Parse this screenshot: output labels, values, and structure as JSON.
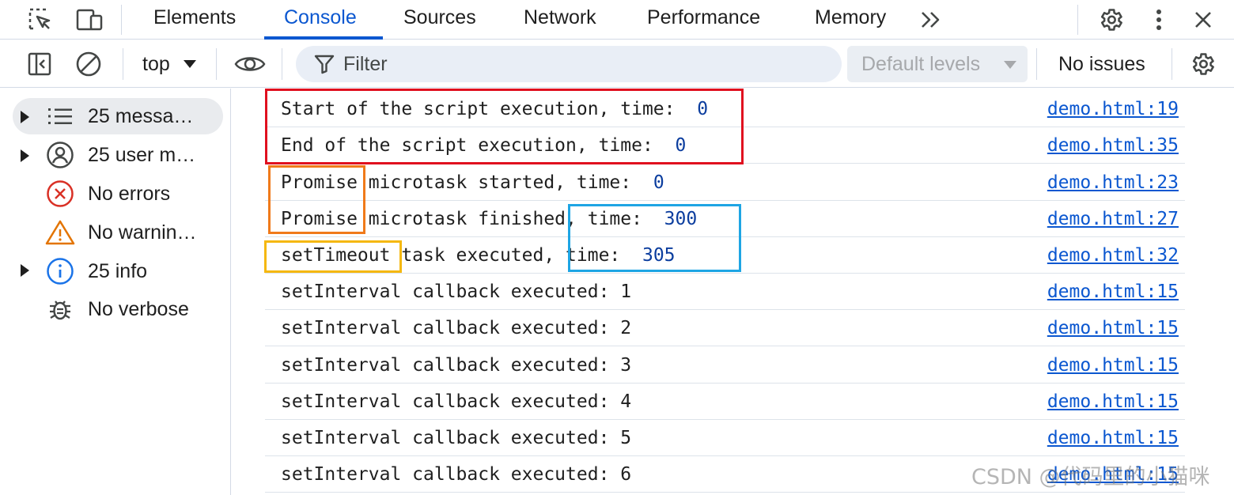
{
  "toolbar_top": {
    "icons": [
      "select-element-icon",
      "device-toolbar-icon"
    ],
    "tabs": [
      {
        "label": "Elements",
        "active": false
      },
      {
        "label": "Console",
        "active": true
      },
      {
        "label": "Sources",
        "active": false
      },
      {
        "label": "Network",
        "active": false
      },
      {
        "label": "Performance",
        "active": false
      },
      {
        "label": "Memory",
        "active": false
      }
    ],
    "more_tabs_glyph": "»",
    "right_icons": [
      "settings-icon",
      "more-options-icon",
      "close-icon"
    ]
  },
  "console_toolbar": {
    "context": "top",
    "filter": {
      "placeholder": "Filter",
      "value": ""
    },
    "levels": "Default levels",
    "issues": "No issues"
  },
  "sidebar": {
    "items": [
      {
        "label": "25 messa…",
        "icon": "list-icon",
        "expandable": true,
        "selected": true
      },
      {
        "label": "25 user m…",
        "icon": "user-icon",
        "expandable": true,
        "selected": false
      },
      {
        "label": "No errors",
        "icon": "error-icon",
        "expandable": false,
        "selected": false
      },
      {
        "label": "No warnin…",
        "icon": "warning-icon",
        "expandable": false,
        "selected": false
      },
      {
        "label": "25 info",
        "icon": "info-icon",
        "expandable": true,
        "selected": false
      },
      {
        "label": "No verbose",
        "icon": "bug-icon",
        "expandable": false,
        "selected": false
      }
    ]
  },
  "messages": [
    {
      "text": "Start of the script execution, time:",
      "value": "0",
      "source": "demo.html:19"
    },
    {
      "text": "End of the script execution, time:",
      "value": "0",
      "source": "demo.html:35"
    },
    {
      "text": "Promise microtask started, time:",
      "value": "0",
      "source": "demo.html:23"
    },
    {
      "text": "Promise microtask finished, time:",
      "value": "300",
      "source": "demo.html:27"
    },
    {
      "text": "setTimeout task executed, time:",
      "value": "305",
      "source": "demo.html:32"
    },
    {
      "text": "setInterval callback executed: 1",
      "value": "",
      "source": "demo.html:15"
    },
    {
      "text": "setInterval callback executed: 2",
      "value": "",
      "source": "demo.html:15"
    },
    {
      "text": "setInterval callback executed: 3",
      "value": "",
      "source": "demo.html:15"
    },
    {
      "text": "setInterval callback executed: 4",
      "value": "",
      "source": "demo.html:15"
    },
    {
      "text": "setInterval callback executed: 5",
      "value": "",
      "source": "demo.html:15"
    },
    {
      "text": "setInterval callback executed: 6",
      "value": "",
      "source": "demo.html:15"
    }
  ],
  "annotations": [
    {
      "name": "script-execution-highlight",
      "color": "#e0101f"
    },
    {
      "name": "promise-highlight",
      "color": "#f07a1a"
    },
    {
      "name": "settimeout-highlight",
      "color": "#f5b80f"
    },
    {
      "name": "time-value-highlight",
      "color": "#1ea5e4"
    }
  ],
  "watermark": "CSDN @代码里的小猫咪",
  "colors": {
    "accent": "#0b57d0",
    "link": "#0b57d0",
    "number": "#0b3d9e",
    "error": "#d93025",
    "warning": "#e37400",
    "info": "#1a73e8"
  }
}
